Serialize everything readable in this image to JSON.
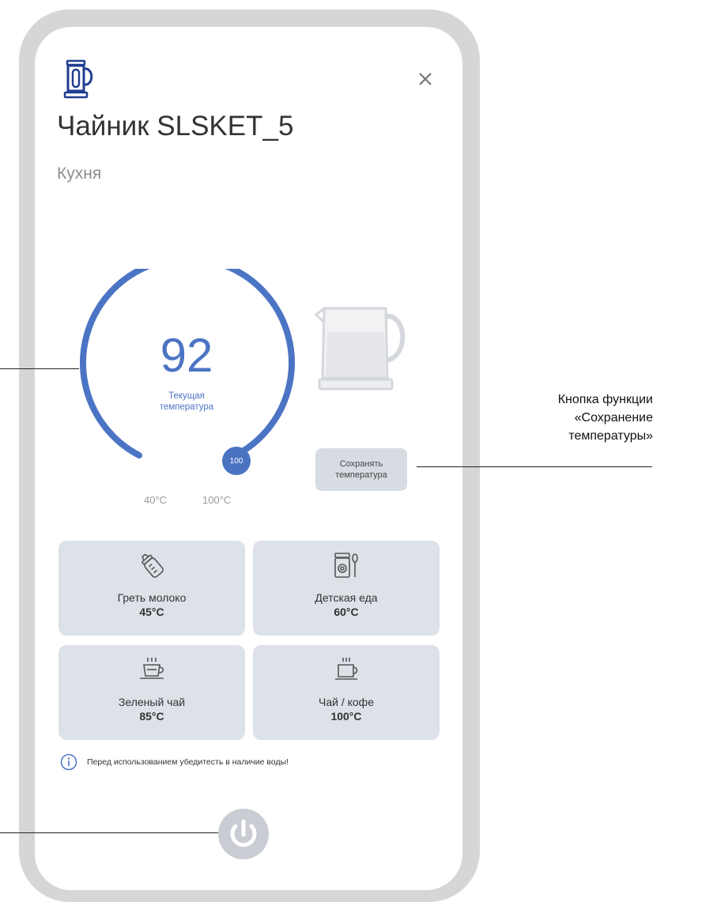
{
  "device": {
    "name": "Чайник SLSKET_5",
    "room": "Кухня"
  },
  "gauge": {
    "current": "92",
    "label": "Текущая\nтемпература",
    "knob_value": "100",
    "min_label": "40°C",
    "max_label": "100°C"
  },
  "keep_warm": {
    "label": "Сохранять\nтемпература"
  },
  "modes": [
    {
      "name": "Греть молоко",
      "temp": "45°C",
      "icon": "baby-bottle-icon"
    },
    {
      "name": "Детская еда",
      "temp": "60°C",
      "icon": "baby-food-jar-icon"
    },
    {
      "name": "Зеленый чай",
      "temp": "85°C",
      "icon": "teacup-saucer-icon"
    },
    {
      "name": "Чай / кофе",
      "temp": "100°C",
      "icon": "coffee-cup-icon"
    }
  ],
  "notice": "Перед использованием убедитесть в наличие воды!",
  "callout": {
    "text": "Кнопка функции\n«Сохранение\nтемпературы»"
  },
  "colors": {
    "accent": "#4c74c4",
    "tile_bg": "#dde1e8",
    "frame": "#d6d6d6"
  }
}
